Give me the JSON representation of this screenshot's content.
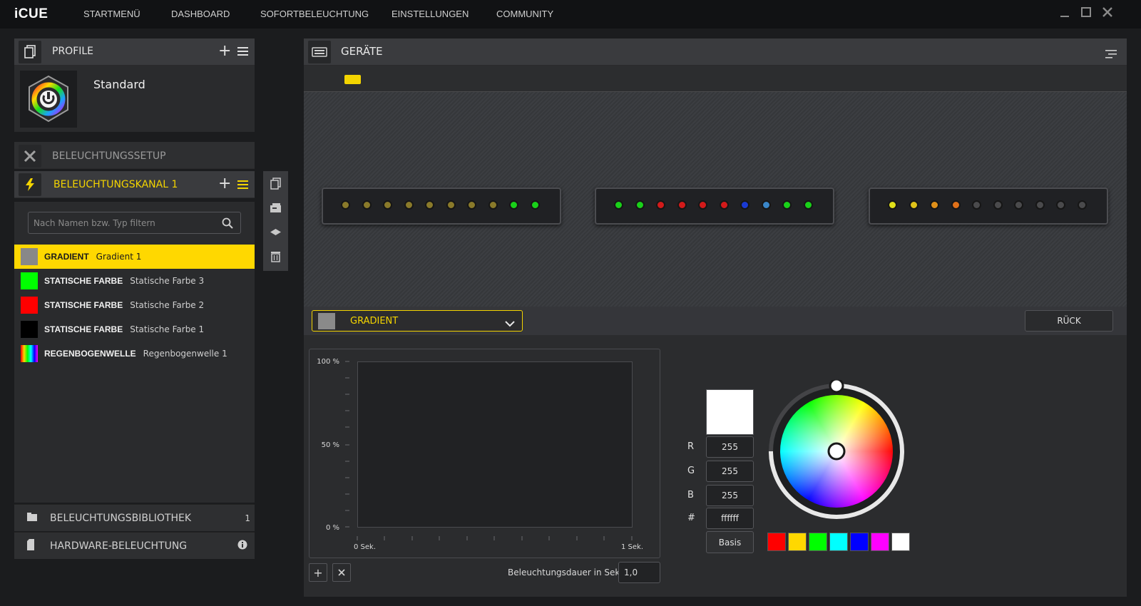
{
  "app": {
    "logo": "iCUE"
  },
  "nav": [
    "STARTMENÜ",
    "DASHBOARD",
    "SOFORTBELEUCHTUNG",
    "EINSTELLUNGEN",
    "COMMUNITY"
  ],
  "window_controls": [
    "minimize-icon",
    "maximize-icon",
    "close-icon"
  ],
  "profile": {
    "header": "PROFILE",
    "name": "Standard"
  },
  "lighting_setup": {
    "label": "BELEUCHTUNGSSETUP"
  },
  "channel": {
    "label": "BELEUCHTUNGSKANAL 1"
  },
  "filter": {
    "placeholder": "Nach Namen bzw. Typ filtern",
    "value": ""
  },
  "layers": [
    {
      "type": "GRADIENT",
      "name": "Gradient 1",
      "color": "#888888",
      "selected": true
    },
    {
      "type": "STATISCHE FARBE",
      "name": "Statische Farbe 3",
      "color": "#00ff00",
      "selected": false
    },
    {
      "type": "STATISCHE FARBE",
      "name": "Statische Farbe 2",
      "color": "#ff0000",
      "selected": false
    },
    {
      "type": "STATISCHE FARBE",
      "name": "Statische Farbe 1",
      "color": "#000000",
      "selected": false
    },
    {
      "type": "REGENBOGENWELLE",
      "name": "Regenbogenwelle 1",
      "color": "rainbow",
      "selected": false
    }
  ],
  "side_tools": [
    "copy-icon",
    "paste-icon",
    "layer-icon",
    "trash-icon"
  ],
  "library": {
    "label": "BELEUCHTUNGSBIBLIOTHEK",
    "count": "1"
  },
  "hardware": {
    "label": "HARDWARE-BELEUCHTUNG"
  },
  "devices": {
    "header": "GERÄTE"
  },
  "led_strips": [
    [
      "#8a7a2a",
      "#8a7a2a",
      "#8a7a2a",
      "#8a7a2a",
      "#8a7a2a",
      "#8a7a2a",
      "#8a7a2a",
      "#8a7a2a",
      "#19d119",
      "#19d119"
    ],
    [
      "#19d119",
      "#19d119",
      "#d31a1a",
      "#d31a1a",
      "#d31a1a",
      "#d31a1a",
      "#1a3ad3",
      "#3a86c8",
      "#19d119",
      "#19d119"
    ],
    [
      "#e0e019",
      "#e0c319",
      "#e09019",
      "#e07019",
      "#4a4a4c",
      "#4a4a4c",
      "#4a4a4c",
      "#4a4a4c",
      "#4a4a4c",
      "#4a4a4c"
    ]
  ],
  "effect": {
    "selected": "GRADIENT",
    "swatch": "#8a8a8a",
    "back_label": "RÜCK"
  },
  "graph": {
    "y_labels": [
      "100 %",
      "50 %",
      "0 %"
    ],
    "x_start": "0 Sek.",
    "x_end": "1 Sek."
  },
  "duration": {
    "label": "Beleuchtungsdauer in Sek.",
    "value": "1,0"
  },
  "color": {
    "preview": "#ffffff",
    "r_label": "R",
    "g_label": "G",
    "b_label": "B",
    "hex_label": "#",
    "r": "255",
    "g": "255",
    "b": "255",
    "hex": "ffffff",
    "basis_label": "Basis",
    "presets": [
      "#ff0000",
      "#ffd800",
      "#00ff00",
      "#00ffff",
      "#0000ff",
      "#ff00ff",
      "#ffffff"
    ]
  }
}
